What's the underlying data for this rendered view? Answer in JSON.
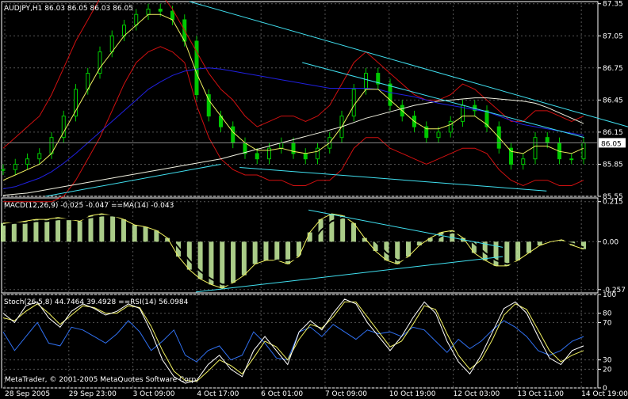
{
  "chart_data": [
    {
      "type": "line",
      "title": "AUDJPY,H1  86.03 86.05 86.03 86.05",
      "ylim": [
        85.55,
        87.37
      ],
      "y_ticks": [
        "87.35",
        "87.05",
        "86.75",
        "86.45",
        "86.15",
        "85.85",
        "85.55"
      ],
      "current_price": "86.05",
      "x_ticks": [
        "28 Sep 2005",
        "29 Sep 23:00",
        "3 Oct 09:00",
        "4 Oct 17:00",
        "6 Oct 01:00",
        "7 Oct 09:00",
        "10 Oct 19:00",
        "12 Oct 03:00",
        "13 Oct 11:00",
        "14 Oct 19:00"
      ],
      "series": [
        {
          "values": [
            85.8,
            85.85,
            85.9,
            85.95,
            86.1,
            86.3,
            86.55,
            86.7,
            86.9,
            87.05,
            87.15,
            87.25,
            87.3,
            87.28,
            87.2,
            87.0,
            86.5,
            86.3,
            86.2,
            86.05,
            85.95,
            85.9,
            86.0,
            86.05,
            85.95,
            85.9,
            86.0,
            86.1,
            86.3,
            86.55,
            86.7,
            86.6,
            86.4,
            86.3,
            86.2,
            86.1,
            86.15,
            86.25,
            86.4,
            86.35,
            86.2,
            86.0,
            85.85,
            85.9,
            86.1,
            86.05,
            85.9,
            85.9,
            86.05
          ]
        },
        {
          "values": [
            85.7,
            85.75,
            85.8,
            85.85,
            85.95,
            86.15,
            86.35,
            86.55,
            86.75,
            86.9,
            87.05,
            87.15,
            87.25,
            87.25,
            87.2,
            87.0,
            86.7,
            86.45,
            86.3,
            86.15,
            86.05,
            85.98,
            85.98,
            86.0,
            85.97,
            85.95,
            85.97,
            86.05,
            86.2,
            86.4,
            86.55,
            86.55,
            86.45,
            86.35,
            86.25,
            86.18,
            86.18,
            86.22,
            86.3,
            86.3,
            86.22,
            86.1,
            85.97,
            85.95,
            86.02,
            86.02,
            85.97,
            85.95,
            86.0
          ]
        },
        {
          "values": [
            85.62,
            85.64,
            85.68,
            85.72,
            85.78,
            85.86,
            85.95,
            86.05,
            86.15,
            86.25,
            86.35,
            86.45,
            86.55,
            86.62,
            86.68,
            86.72,
            86.74,
            86.75,
            86.74,
            86.72,
            86.7,
            86.68,
            86.66,
            86.64,
            86.62,
            86.6,
            86.58,
            86.56,
            86.56,
            86.56,
            86.56,
            86.55,
            86.52,
            86.5,
            86.48,
            86.45,
            86.42,
            86.4,
            86.38,
            86.36,
            86.34,
            86.3,
            86.26,
            86.22,
            86.2,
            86.18,
            86.16,
            86.14,
            86.12
          ]
        },
        {
          "values": [
            85.56,
            85.57,
            85.58,
            85.6,
            85.62,
            85.64,
            85.66,
            85.68,
            85.7,
            85.72,
            85.74,
            85.76,
            85.78,
            85.8,
            85.82,
            85.84,
            85.86,
            85.88,
            85.9,
            85.93,
            85.96,
            85.99,
            86.02,
            86.05,
            86.08,
            86.11,
            86.14,
            86.17,
            86.2,
            86.24,
            86.28,
            86.31,
            86.34,
            86.37,
            86.4,
            86.42,
            86.44,
            86.45,
            86.46,
            86.47,
            86.47,
            86.46,
            86.45,
            86.44,
            86.42,
            86.38,
            86.33,
            86.28,
            86.23
          ]
        },
        {
          "values": [
            86.0,
            86.1,
            86.2,
            86.3,
            86.5,
            86.75,
            87.0,
            87.2,
            87.4,
            87.45,
            87.45,
            87.5,
            87.55,
            87.45,
            87.3,
            87.1,
            86.9,
            86.7,
            86.55,
            86.45,
            86.3,
            86.2,
            86.25,
            86.3,
            86.3,
            86.25,
            86.3,
            86.4,
            86.6,
            86.8,
            86.9,
            86.8,
            86.7,
            86.6,
            86.5,
            86.45,
            86.45,
            86.5,
            86.6,
            86.55,
            86.45,
            86.35,
            86.25,
            86.25,
            86.35,
            86.35,
            86.3,
            86.25,
            86.3
          ]
        },
        {
          "values": [
            85.5,
            85.5,
            85.5,
            85.5,
            85.5,
            85.55,
            85.7,
            85.9,
            86.1,
            86.35,
            86.6,
            86.8,
            86.9,
            86.95,
            86.9,
            86.8,
            86.4,
            86.1,
            85.9,
            85.8,
            85.75,
            85.75,
            85.7,
            85.7,
            85.65,
            85.65,
            85.7,
            85.7,
            85.8,
            86.0,
            86.1,
            86.1,
            86.0,
            85.95,
            85.9,
            85.85,
            85.9,
            85.95,
            86.0,
            86.0,
            85.95,
            85.8,
            85.7,
            85.65,
            85.7,
            85.7,
            85.65,
            85.65,
            85.7
          ]
        }
      ],
      "trendlines": [
        {
          "x": [
            0.3,
            1.0
          ],
          "y": [
            87.37,
            86.2
          ]
        },
        {
          "x": [
            0.48,
            0.93
          ],
          "y": [
            86.8,
            86.1
          ]
        },
        {
          "x": [
            0.38,
            0.87
          ],
          "y": [
            85.82,
            85.6
          ]
        },
        {
          "x": [
            0.07,
            0.35
          ],
          "y": [
            85.55,
            85.85
          ]
        }
      ]
    },
    {
      "type": "bar",
      "title": "MACD(12,26,9) -0.025 -0.047 ==MA(14) -0.043",
      "ylim": [
        -0.275,
        0.235
      ],
      "y_ticks": [
        "0.215",
        "0.00",
        "-0.257"
      ],
      "values": [
        0.1,
        0.1,
        0.11,
        0.12,
        0.12,
        0.13,
        0.12,
        0.11,
        0.14,
        0.15,
        0.14,
        0.12,
        0.09,
        0.08,
        0.06,
        0.02,
        -0.08,
        -0.15,
        -0.2,
        -0.23,
        -0.25,
        -0.22,
        -0.18,
        -0.12,
        -0.1,
        -0.1,
        -0.12,
        -0.08,
        0.05,
        0.12,
        0.15,
        0.14,
        0.1,
        0.02,
        -0.05,
        -0.1,
        -0.12,
        -0.08,
        -0.02,
        0.02,
        0.05,
        0.06,
        0.02,
        -0.06,
        -0.1,
        -0.13,
        -0.13,
        -0.1,
        -0.06,
        -0.02,
        0.0,
        0.01,
        -0.02,
        -0.04
      ],
      "series": [
        {
          "values": [
            0.1,
            0.1,
            0.11,
            0.12,
            0.12,
            0.13,
            0.12,
            0.11,
            0.14,
            0.15,
            0.14,
            0.12,
            0.09,
            0.08,
            0.06,
            0.02,
            -0.08,
            -0.15,
            -0.2,
            -0.23,
            -0.25,
            -0.22,
            -0.18,
            -0.12,
            -0.1,
            -0.1,
            -0.12,
            -0.08,
            0.05,
            0.12,
            0.15,
            0.14,
            0.1,
            0.02,
            -0.05,
            -0.1,
            -0.12,
            -0.08,
            -0.02,
            0.02,
            0.05,
            0.06,
            0.02,
            -0.06,
            -0.1,
            -0.13,
            -0.13,
            -0.1,
            -0.06,
            -0.02,
            0.0,
            0.01,
            -0.02,
            -0.04
          ]
        },
        {
          "values": [
            0.09,
            0.1,
            0.1,
            0.11,
            0.11,
            0.12,
            0.12,
            0.12,
            0.13,
            0.14,
            0.14,
            0.13,
            0.11,
            0.09,
            0.07,
            0.04,
            -0.03,
            -0.1,
            -0.16,
            -0.2,
            -0.23,
            -0.23,
            -0.2,
            -0.16,
            -0.12,
            -0.1,
            -0.1,
            -0.09,
            -0.02,
            0.06,
            0.11,
            0.13,
            0.12,
            0.07,
            0.0,
            -0.06,
            -0.1,
            -0.09,
            -0.05,
            -0.01,
            0.03,
            0.05,
            0.04,
            -0.01,
            -0.06,
            -0.1,
            -0.12,
            -0.11,
            -0.08,
            -0.04,
            -0.01,
            0.0,
            -0.01,
            -0.03
          ]
        }
      ],
      "trendlines": [
        {
          "x": [
            0.49,
            0.8
          ],
          "y": [
            0.17,
            -0.03
          ]
        },
        {
          "x": [
            0.31,
            0.8
          ],
          "y": [
            -0.27,
            -0.08
          ]
        }
      ]
    },
    {
      "type": "line",
      "title": "Stoch(26,5,8) 44.7464 39.4928 ==RSI(14) 56.0984",
      "footer": "MetaTrader, © 2001-2005 MetaQuotes Software Corp.",
      "ylim": [
        0,
        100
      ],
      "y_ticks": [
        "100",
        "80",
        "70",
        "30",
        "20",
        "0"
      ],
      "series": [
        {
          "values": [
            80,
            70,
            88,
            92,
            75,
            65,
            82,
            90,
            85,
            78,
            82,
            90,
            85,
            60,
            30,
            12,
            5,
            8,
            25,
            35,
            20,
            12,
            40,
            55,
            40,
            25,
            60,
            72,
            62,
            80,
            95,
            90,
            70,
            55,
            40,
            55,
            75,
            92,
            80,
            50,
            28,
            15,
            35,
            60,
            85,
            92,
            80,
            55,
            32,
            25,
            40,
            45
          ]
        },
        {
          "values": [
            75,
            72,
            82,
            90,
            80,
            68,
            78,
            88,
            86,
            80,
            80,
            88,
            86,
            66,
            40,
            18,
            8,
            7,
            18,
            30,
            24,
            15,
            32,
            50,
            44,
            30,
            52,
            68,
            64,
            76,
            92,
            92,
            76,
            60,
            44,
            50,
            68,
            88,
            84,
            58,
            35,
            20,
            30,
            52,
            78,
            90,
            84,
            62,
            40,
            28,
            35,
            40
          ]
        },
        {
          "values": [
            60,
            40,
            55,
            70,
            48,
            45,
            65,
            62,
            55,
            48,
            58,
            72,
            60,
            40,
            50,
            62,
            35,
            28,
            40,
            45,
            30,
            35,
            60,
            48,
            32,
            30,
            60,
            65,
            55,
            68,
            60,
            52,
            62,
            58,
            60,
            55,
            65,
            62,
            50,
            38,
            52,
            42,
            50,
            62,
            72,
            65,
            55,
            40,
            35,
            40,
            50,
            55
          ]
        }
      ]
    }
  ]
}
